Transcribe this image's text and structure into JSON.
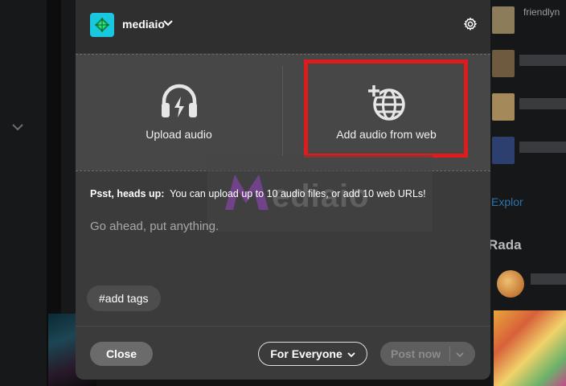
{
  "background": {
    "blog_name": "friendlyn",
    "explore_link": "Explor",
    "section_title": "Rada"
  },
  "header": {
    "blog_name": "mediaio",
    "logo_icon": "diamond-logo-icon",
    "settings_icon": "gear-icon"
  },
  "upload_options": [
    {
      "label": "Upload audio",
      "icon": "headphones-upload-icon"
    },
    {
      "label": "Add audio from web",
      "icon": "globe-plus-icon"
    }
  ],
  "watermark": {
    "text": "ediaio"
  },
  "tip": {
    "bold": "Psst, heads up:",
    "text": "You can upload up to 10 audio files, or add 10 web URLs!"
  },
  "editor": {
    "placeholder": "Go ahead, put anything."
  },
  "tags": {
    "label": "#add tags"
  },
  "footer": {
    "close_label": "Close",
    "audience_label": "For Everyone",
    "post_label": "Post now"
  },
  "colors": {
    "highlight": "#e01b1b",
    "logo": "#19c8e0",
    "modal_bg": "#3b3b3b"
  }
}
